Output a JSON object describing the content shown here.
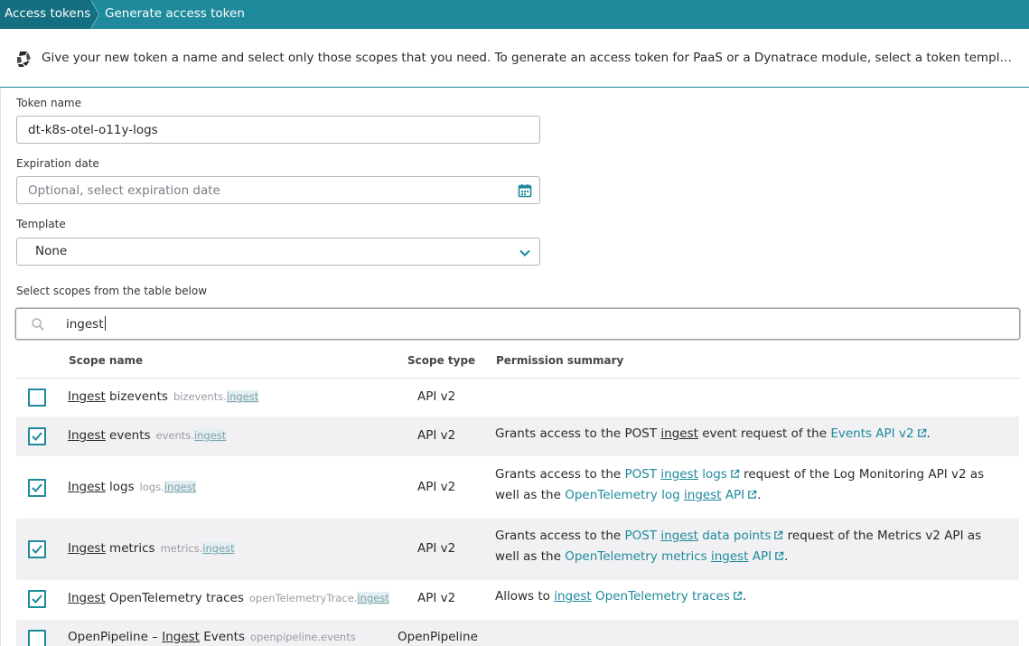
{
  "breadcrumb": {
    "items": [
      "Access tokens",
      "Generate access token"
    ]
  },
  "info": {
    "icon": "dynatrace-logo-icon",
    "text": "Give your new token a name and select only those scopes that you need. To generate an access token for PaaS or a Dynatrace module, select a token template. For deta..."
  },
  "form": {
    "token_name_label": "Token name",
    "token_name_value": "dt-k8s-otel-o11y-logs",
    "expiration_label": "Expiration date",
    "expiration_placeholder": "Optional, select expiration date",
    "template_label": "Template",
    "template_value": "None",
    "scopes_label": "Select scopes from the table below",
    "search_value": "ingest"
  },
  "table": {
    "headers": {
      "name": "Scope name",
      "type": "Scope type",
      "summary": "Permission summary"
    },
    "rows": [
      {
        "checked": false,
        "name_hl": "Ingest",
        "name_rest": " bizevents",
        "key_pre": "bizevents.",
        "key_hl": "ingest",
        "key_post": "",
        "type": "API v2"
      },
      {
        "checked": true,
        "name_hl": "Ingest",
        "name_rest": " events",
        "key_pre": "events.",
        "key_hl": "ingest",
        "key_post": "",
        "type": "API v2",
        "summary": {
          "t1": "Grants access to the POST ",
          "hl": "ingest",
          "t2": " event request of the ",
          "link": "Events API v2",
          "t3": "."
        }
      },
      {
        "checked": true,
        "name_hl": "Ingest",
        "name_rest": " logs",
        "key_pre": "logs.",
        "key_hl": "ingest",
        "key_post": "",
        "type": "API v2",
        "summary": {
          "t1": "Grants access to the ",
          "link1a": "POST ",
          "hl1": "ingest",
          "link1b": " logs",
          "t2": " request of the Log Monitoring API v2 as well as the ",
          "link2a": "OpenTelemetry log ",
          "hl2": "ingest",
          "link2b": " API",
          "t3": "."
        }
      },
      {
        "checked": true,
        "name_hl": "Ingest",
        "name_rest": " metrics",
        "key_pre": "metrics.",
        "key_hl": "ingest",
        "key_post": "",
        "type": "API v2",
        "summary": {
          "t1": "Grants access to the ",
          "link1a": "POST ",
          "hl1": "ingest",
          "link1b": " data points",
          "t2": " request of the Metrics v2 API as well as the ",
          "link2a": "OpenTelemetry metrics ",
          "hl2": "ingest",
          "link2b": " API",
          "t3": "."
        }
      },
      {
        "checked": true,
        "name_hl": "Ingest",
        "name_rest": " OpenTelemetry traces",
        "key_pre": "openTelemetryTrace.",
        "key_hl": "ingest",
        "key_post": "",
        "type": "API v2",
        "summary": {
          "t1": "Allows to ",
          "hl": "ingest",
          "link": " OpenTelemetry traces",
          "t3": "."
        }
      },
      {
        "checked": false,
        "name_pre": "OpenPipeline – ",
        "name_hl": "Ingest",
        "name_rest": " Events",
        "key_pre": "openpipeline.events",
        "key_hl": "",
        "key_post": "",
        "type": "OpenPipeline"
      }
    ]
  },
  "colors": {
    "accent": "#1e8a9c",
    "header_dark": "#146f80",
    "row_alt": "#f1f1f3"
  }
}
